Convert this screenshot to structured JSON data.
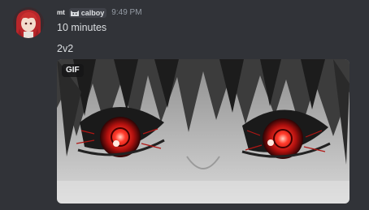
{
  "message": {
    "author": "mt",
    "tag": "calboy",
    "timestamp": "9:49 PM",
    "lines": [
      "10 minutes",
      "2v2"
    ]
  },
  "attachment": {
    "badge": "GIF"
  },
  "icons": {
    "avatar": "red-haired-anime-avatar",
    "tag_icon": "cat-icon"
  },
  "colors": {
    "background": "#313338",
    "text": "#dbdee1",
    "muted": "#949ba4",
    "eye_glow": "#e0201c"
  }
}
